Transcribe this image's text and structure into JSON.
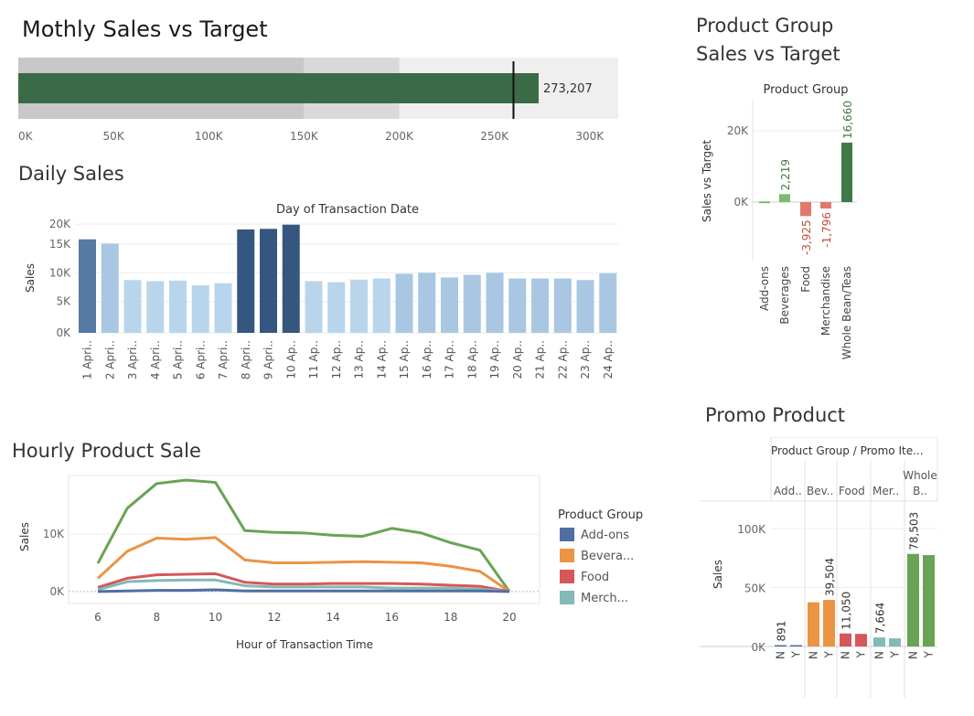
{
  "colors": {
    "bullet_bar": "#3b6b46",
    "band_dark": "#c8c8c8",
    "band_mid": "#d9d9d9",
    "band_light": "#efefef",
    "daily_dark": "#35577f",
    "daily_mid": "#567aa4",
    "daily_light": "#a9c7e2",
    "daily_lighter": "#b9d5ec",
    "positive": "#7bbb6a",
    "negative": "#e1796a",
    "whole_bean": "#3f7a46",
    "addons": "#4e6fa2",
    "beverages": "#ea9444",
    "food": "#d75759",
    "merch": "#82bab6",
    "wholebean_line": "#6aa355",
    "promo_addons": "#4e6fa2",
    "promo_bev": "#ea9444",
    "promo_food": "#d75759",
    "promo_merch": "#82bab6",
    "promo_whole": "#6aa355"
  },
  "monthly": {
    "title": "Mothly Sales vs Target",
    "value_label": "273,207"
  },
  "daily": {
    "title": "Daily Sales",
    "header": "Day of Transaction Date",
    "ylabel": "Sales"
  },
  "hourly": {
    "title": "Hourly Product Sale",
    "ylabel": "Sales",
    "xlabel": "Hour of Transaction Time",
    "legend_title": "Product Group",
    "legend": [
      "Add-ons",
      "Bevera...",
      "Food",
      "Merch..."
    ]
  },
  "group": {
    "title_line1": "Product Group",
    "title_line2": "Sales vs Target",
    "header": "Product Group",
    "ylabel": "Sales vs Target"
  },
  "promo": {
    "title": "Promo Product",
    "header": "Product Group / Promo Ite...",
    "ylabel": "Sales"
  },
  "chart_data": [
    {
      "type": "bar",
      "title": "Mothly Sales vs Target",
      "orientation": "horizontal",
      "value": 273207,
      "target": 260000,
      "bands": [
        150000,
        200000,
        315000
      ],
      "xlim": [
        0,
        315000
      ],
      "xticks": [
        "0K",
        "50K",
        "100K",
        "150K",
        "200K",
        "250K",
        "300K"
      ],
      "tick_values": [
        0,
        50000,
        100000,
        150000,
        200000,
        250000,
        300000
      ],
      "data_labels": [
        "273,207"
      ]
    },
    {
      "type": "bar",
      "title": "Daily Sales",
      "xlabel": "Day of Transaction Date",
      "ylabel": "Sales",
      "categories": [
        "1 Apri..",
        "2 Apri..",
        "3 Apri..",
        "4 Apri..",
        "5 Apri..",
        "6 Apri..",
        "7 Apri..",
        "8 Apri..",
        "9 Apri..",
        "10 Ap..",
        "11 Ap..",
        "12 Ap..",
        "13 Ap..",
        "14 Ap..",
        "15 Ap..",
        "16 Ap..",
        "17 Ap..",
        "18 Ap..",
        "19 Ap..",
        "20 Ap..",
        "21 Ap..",
        "22 Ap..",
        "23 Ap..",
        "24 Ap.."
      ],
      "values": [
        17900,
        17100,
        10100,
        9900,
        10000,
        9100,
        9500,
        19800,
        19900,
        20700,
        9900,
        9700,
        10200,
        10400,
        11300,
        11500,
        10600,
        11100,
        11500,
        10400,
        10400,
        10400,
        10100,
        11400
      ],
      "shade": [
        2,
        1,
        0,
        0,
        0,
        0,
        0,
        3,
        3,
        3,
        0,
        0,
        0,
        0,
        1,
        1,
        1,
        1,
        1,
        1,
        1,
        1,
        1,
        1
      ],
      "ylim": [
        0,
        21000
      ],
      "yticks": [
        "0K",
        "5K",
        "10K",
        "15K",
        "20K"
      ],
      "ytick_values": [
        0,
        6000,
        11500,
        17000,
        20800
      ]
    },
    {
      "type": "line",
      "title": "Hourly Product Sale",
      "xlabel": "Hour of Transaction Time",
      "ylabel": "Sales",
      "x": [
        6,
        7,
        8,
        9,
        10,
        11,
        12,
        13,
        14,
        15,
        16,
        17,
        18,
        19,
        20
      ],
      "xticks": [
        6,
        8,
        10,
        12,
        14,
        16,
        18,
        20
      ],
      "yticks": [
        "0K",
        "10K"
      ],
      "ytick_values": [
        0,
        10000
      ],
      "ylim": [
        -500,
        21000
      ],
      "series": [
        {
          "name": "Add-ons",
          "values": [
            0,
            100,
            200,
            200,
            300,
            100,
            100,
            100,
            100,
            100,
            100,
            100,
            100,
            100,
            0
          ]
        },
        {
          "name": "Bevera...",
          "values": [
            2300,
            7000,
            9300,
            9100,
            9400,
            5500,
            5000,
            5000,
            5100,
            5200,
            5100,
            5000,
            4400,
            3500,
            0
          ]
        },
        {
          "name": "Food",
          "values": [
            700,
            2300,
            2900,
            3000,
            3100,
            1600,
            1300,
            1300,
            1400,
            1400,
            1400,
            1300,
            1100,
            900,
            0
          ]
        },
        {
          "name": "Merch...",
          "values": [
            300,
            1700,
            1900,
            2000,
            2000,
            1000,
            800,
            800,
            800,
            800,
            600,
            600,
            600,
            400,
            0
          ]
        },
        {
          "name": "",
          "values": [
            4900,
            14500,
            18800,
            19400,
            19000,
            10600,
            10300,
            10200,
            9800,
            9600,
            11000,
            10200,
            8500,
            7200,
            0
          ]
        }
      ]
    },
    {
      "type": "bar",
      "title": "Product Group Sales vs Target",
      "xlabel": "Product Group",
      "ylabel": "Sales vs Target",
      "categories": [
        "Add-ons",
        "Beverages",
        "Food",
        "Merchandise",
        "Whole Bean/Teas"
      ],
      "values": [
        200,
        2219,
        -3925,
        -1796,
        16660
      ],
      "data_labels": [
        "",
        "2,219",
        "-3,925",
        "-1,796",
        "16,660"
      ],
      "yticks": [
        "0K",
        "20K"
      ],
      "ytick_values": [
        0,
        20000
      ]
    },
    {
      "type": "bar",
      "title": "Promo Product",
      "xlabel": "Product Group / Promo Ite...",
      "ylabel": "Sales",
      "groups": [
        "Add..",
        "Bev..",
        "Food",
        "Mer..",
        "Whole B.."
      ],
      "categories": [
        "N",
        "Y",
        "N",
        "Y",
        "N",
        "Y",
        "N",
        "Y",
        "N",
        "Y"
      ],
      "values": [
        891,
        300,
        37500,
        39504,
        11050,
        10700,
        7664,
        6900,
        78503,
        77500
      ],
      "data_labels": [
        "891",
        "",
        "",
        "39,504",
        "11,050",
        "",
        "7,664",
        "",
        "78,503",
        ""
      ],
      "yticks": [
        "0K",
        "50K",
        "100K"
      ],
      "ytick_values": [
        0,
        50000,
        100000
      ]
    }
  ]
}
